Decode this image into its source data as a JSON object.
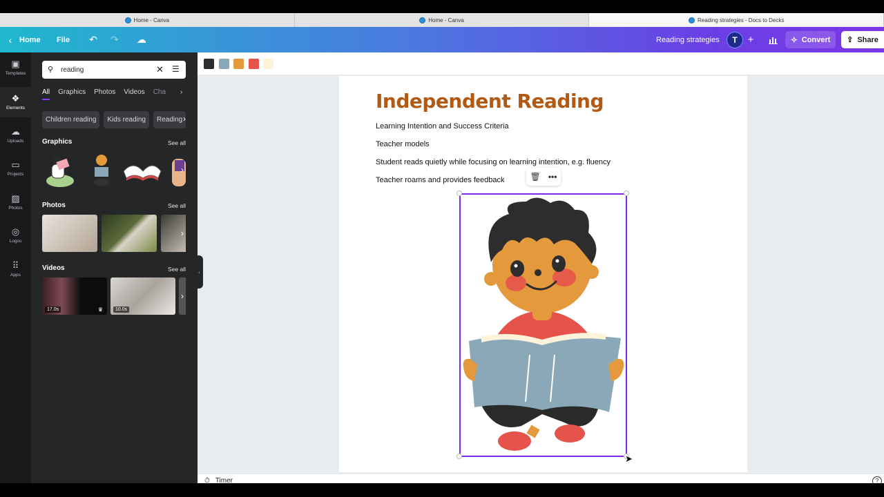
{
  "browser": {
    "tabs": [
      {
        "label": "Home - Canva"
      },
      {
        "label": "Home - Canva"
      },
      {
        "label": "Reading strategies - Docs to Decks"
      }
    ]
  },
  "header": {
    "home_label": "Home",
    "file_label": "File",
    "doc_name": "Reading strategies",
    "avatar_initial": "T",
    "convert_label": "Convert",
    "share_label": "Share"
  },
  "rail": {
    "items": [
      {
        "label": "Templates",
        "icon": "templates-icon"
      },
      {
        "label": "Elements",
        "icon": "elements-icon"
      },
      {
        "label": "Uploads",
        "icon": "uploads-icon"
      },
      {
        "label": "Projects",
        "icon": "projects-icon"
      },
      {
        "label": "Photos",
        "icon": "photos-icon"
      },
      {
        "label": "Logos",
        "icon": "logos-icon"
      },
      {
        "label": "Apps",
        "icon": "apps-icon"
      }
    ]
  },
  "panel": {
    "search_value": "reading",
    "tabs": [
      "All",
      "Graphics",
      "Photos",
      "Videos",
      "Cha"
    ],
    "chips": [
      "Children reading",
      "Kids reading",
      "Reading"
    ],
    "graphics_title": "Graphics",
    "photos_title": "Photos",
    "videos_title": "Videos",
    "see_all": "See all",
    "videos": [
      {
        "duration": "17.0s"
      },
      {
        "duration": "10.0s"
      }
    ]
  },
  "colors": {
    "accent": "#8b3dff",
    "swatches": [
      "#2d2d2d",
      "#8ba8b9",
      "#e49a3c",
      "#e5534b",
      "#fdf3d8"
    ]
  },
  "document": {
    "title": "Independent Reading",
    "lines": [
      "Learning Intention and Success Criteria",
      "Teacher models",
      "Student reads quietly while focusing on learning intention, e.g. fluency",
      "Teacher roams and provides feedback"
    ]
  },
  "footer": {
    "timer_label": "Timer",
    "help_label": "?"
  }
}
